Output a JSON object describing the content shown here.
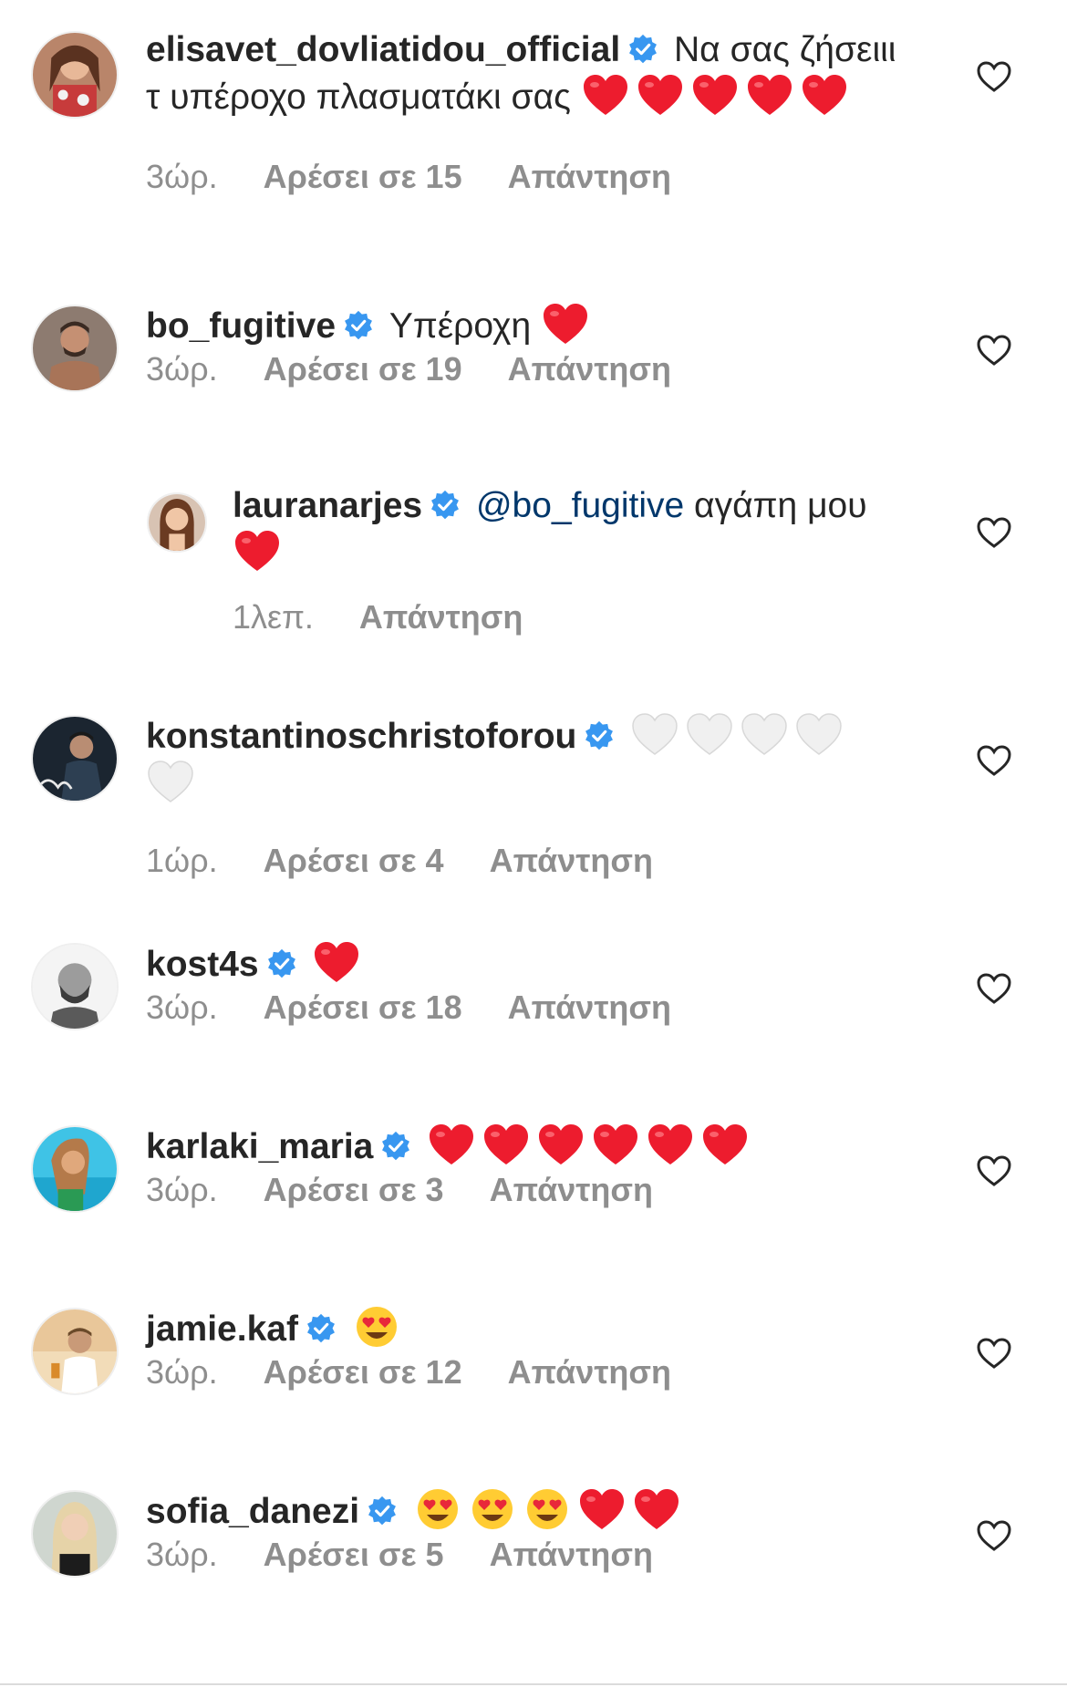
{
  "colors": {
    "text": "#262626",
    "meta": "#8e8e8e",
    "mention": "#00376b",
    "verified": "#3897f0",
    "heart_red": "#ed1c2e"
  },
  "comments": [
    {
      "username": "elisavet_dovliatidou_official",
      "text": "Να σας ζήσειιι τ υπέροχο πλασματάκι σας",
      "emojis": [
        "red-heart",
        "red-heart",
        "red-heart",
        "red-heart",
        "red-heart"
      ],
      "time": "3ώρ.",
      "likes": "Αρέσει σε 15",
      "reply": "Απάντηση"
    },
    {
      "username": "bo_fugitive",
      "text": "Υπέροχη",
      "emojis": [
        "red-heart"
      ],
      "time": "3ώρ.",
      "likes": "Αρέσει σε 19",
      "reply": "Απάντηση"
    },
    {
      "username": "lauranarjes",
      "mention": "@bo_fugitive",
      "text": "αγάπη μου",
      "emojis": [
        "red-heart"
      ],
      "time": "1λεπ.",
      "reply": "Απάντηση"
    },
    {
      "username": "konstantinoschristoforou",
      "text": "",
      "emojis": [
        "white-heart",
        "white-heart",
        "white-heart",
        "white-heart",
        "white-heart"
      ],
      "time": "1ώρ.",
      "likes": "Αρέσει σε 4",
      "reply": "Απάντηση"
    },
    {
      "username": "kost4s",
      "text": "",
      "emojis": [
        "red-heart"
      ],
      "time": "3ώρ.",
      "likes": "Αρέσει σε 18",
      "reply": "Απάντηση"
    },
    {
      "username": "karlaki_maria",
      "text": "",
      "emojis": [
        "red-heart",
        "red-heart",
        "red-heart",
        "red-heart",
        "red-heart",
        "red-heart"
      ],
      "time": "3ώρ.",
      "likes": "Αρέσει σε 3",
      "reply": "Απάντηση"
    },
    {
      "username": "jamie.kaf",
      "text": "",
      "emojis": [
        "heart-eyes"
      ],
      "time": "3ώρ.",
      "likes": "Αρέσει σε 12",
      "reply": "Απάντηση"
    },
    {
      "username": "sofia_danezi",
      "text": "",
      "emojis": [
        "heart-eyes",
        "heart-eyes",
        "heart-eyes",
        "red-heart",
        "red-heart"
      ],
      "time": "3ώρ.",
      "likes": "Αρέσει σε 5",
      "reply": "Απάντηση"
    }
  ]
}
